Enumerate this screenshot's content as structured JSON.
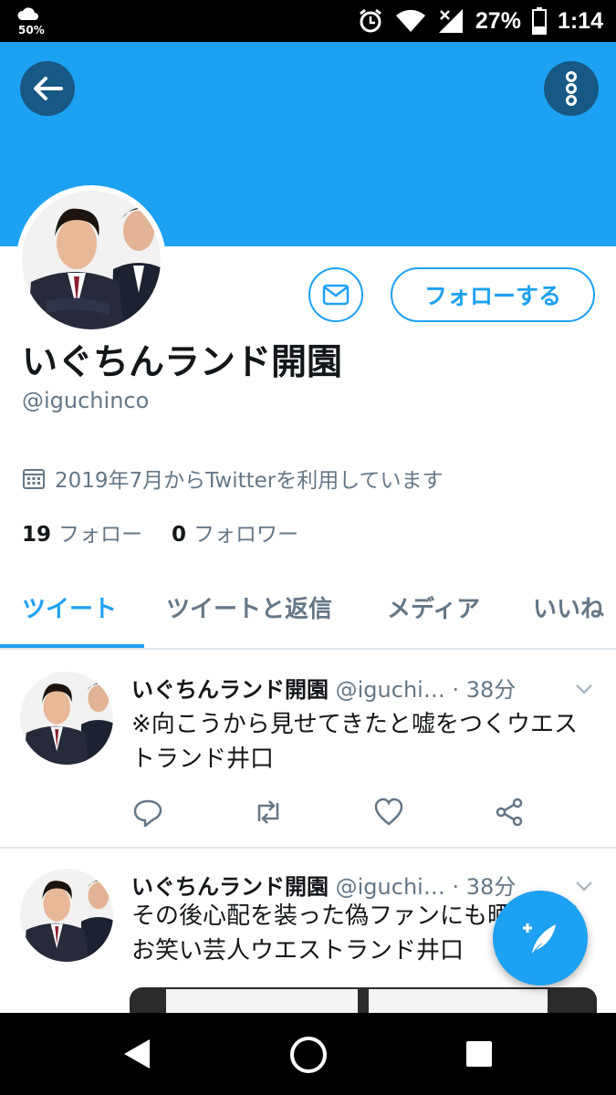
{
  "status_bar": {
    "weather_percent": "50%",
    "battery": "27%",
    "time": "1:14"
  },
  "header": {
    "back_icon": "arrow-left-icon",
    "more_icon": "more-vertical-icon",
    "banner_color": "#1da1f2"
  },
  "profile": {
    "display_name": "いぐちんランド開園",
    "handle": "@iguchinco",
    "joined": "2019年7月からTwitterを利用しています",
    "following_count": "19",
    "following_label": "フォロー",
    "followers_count": "0",
    "followers_label": "フォロワー",
    "follow_button": "フォローする",
    "message_icon": "envelope-icon"
  },
  "tabs": [
    {
      "label": "ツイート",
      "active": true
    },
    {
      "label": "ツイートと返信",
      "active": false
    },
    {
      "label": "メディア",
      "active": false
    },
    {
      "label": "いいね",
      "active": false
    }
  ],
  "tweets": [
    {
      "name": "いぐちんランド開園",
      "handle": "@iguchi…",
      "time": "· 38分",
      "text": "※向こうから見せてきたと嘘をつくウエストランド井口"
    },
    {
      "name": "いぐちんランド開園",
      "handle": "@iguchi…",
      "time": "· 38分",
      "text": "その後心配を装った偽ファンにも晒されるお笑い芸人ウエストランド井口"
    }
  ],
  "fab": {
    "icon": "compose-tweet-icon"
  },
  "colors": {
    "accent": "#1da1f2",
    "secondary_text": "#657786",
    "divider": "#e1e8ed"
  }
}
